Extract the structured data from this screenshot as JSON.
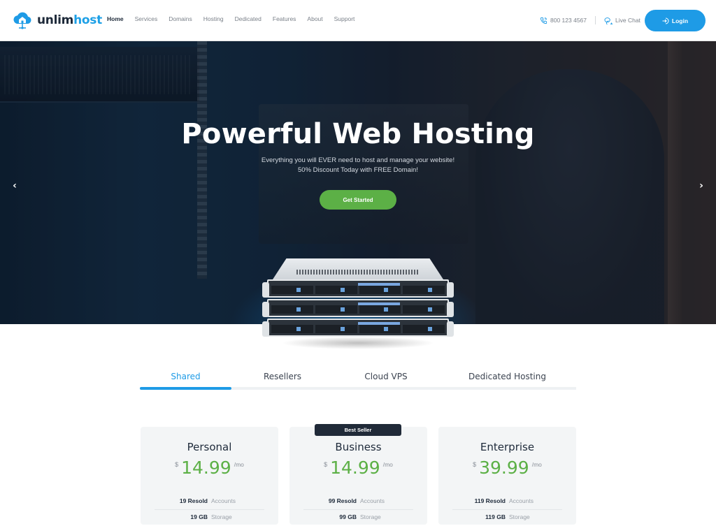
{
  "header": {
    "logo": {
      "text_main": "unlim",
      "text_accent": "host",
      "icon": "cloud-home-icon"
    },
    "nav": [
      {
        "label": "Home",
        "active": true
      },
      {
        "label": "Services",
        "active": false
      },
      {
        "label": "Domains",
        "active": false
      },
      {
        "label": "Hosting",
        "active": false
      },
      {
        "label": "Dedicated",
        "active": false
      },
      {
        "label": "Features",
        "active": false
      },
      {
        "label": "About",
        "active": false
      },
      {
        "label": "Support",
        "active": false
      }
    ],
    "phone": {
      "icon": "phone-icon",
      "number": "800 123 4567"
    },
    "chat": {
      "icon": "chat-icon",
      "label": "Live Chat"
    },
    "login": {
      "icon": "login-icon",
      "label": "Login"
    }
  },
  "hero": {
    "title": "Powerful Web Hosting",
    "subtitle_line1": "Everything you will EVER need to host and manage your website!",
    "subtitle_line2": "50% Discount Today with FREE Domain!",
    "cta_label": "Get Started",
    "prev_arrow": "‹",
    "next_arrow": "›"
  },
  "tabs": [
    {
      "label": "Shared",
      "active": true
    },
    {
      "label": "Resellers",
      "active": false
    },
    {
      "label": "Cloud VPS",
      "active": false
    },
    {
      "label": "Dedicated Hosting",
      "active": false
    }
  ],
  "plans": [
    {
      "name": "Personal",
      "currency": "$",
      "price": "14.99",
      "period": "/mo",
      "badge": null,
      "features": [
        {
          "value": "19 Resold",
          "label": "Accounts"
        },
        {
          "value": "19 GB",
          "label": "Storage"
        }
      ]
    },
    {
      "name": "Business",
      "currency": "$",
      "price": "14.99",
      "period": "/mo",
      "badge": "Best Seller",
      "features": [
        {
          "value": "99 Resold",
          "label": "Accounts"
        },
        {
          "value": "99 GB",
          "label": "Storage"
        }
      ]
    },
    {
      "name": "Enterprise",
      "currency": "$",
      "price": "39.99",
      "period": "/mo",
      "badge": null,
      "features": [
        {
          "value": "119 Resold",
          "label": "Accounts"
        },
        {
          "value": "119 GB",
          "label": "Storage"
        }
      ]
    }
  ],
  "colors": {
    "brand_blue": "#1e9be6",
    "cta_green": "#5cb046",
    "price_green": "#5cb046",
    "dark_text": "#1e2a3a",
    "badge_bg": "#202a38"
  }
}
